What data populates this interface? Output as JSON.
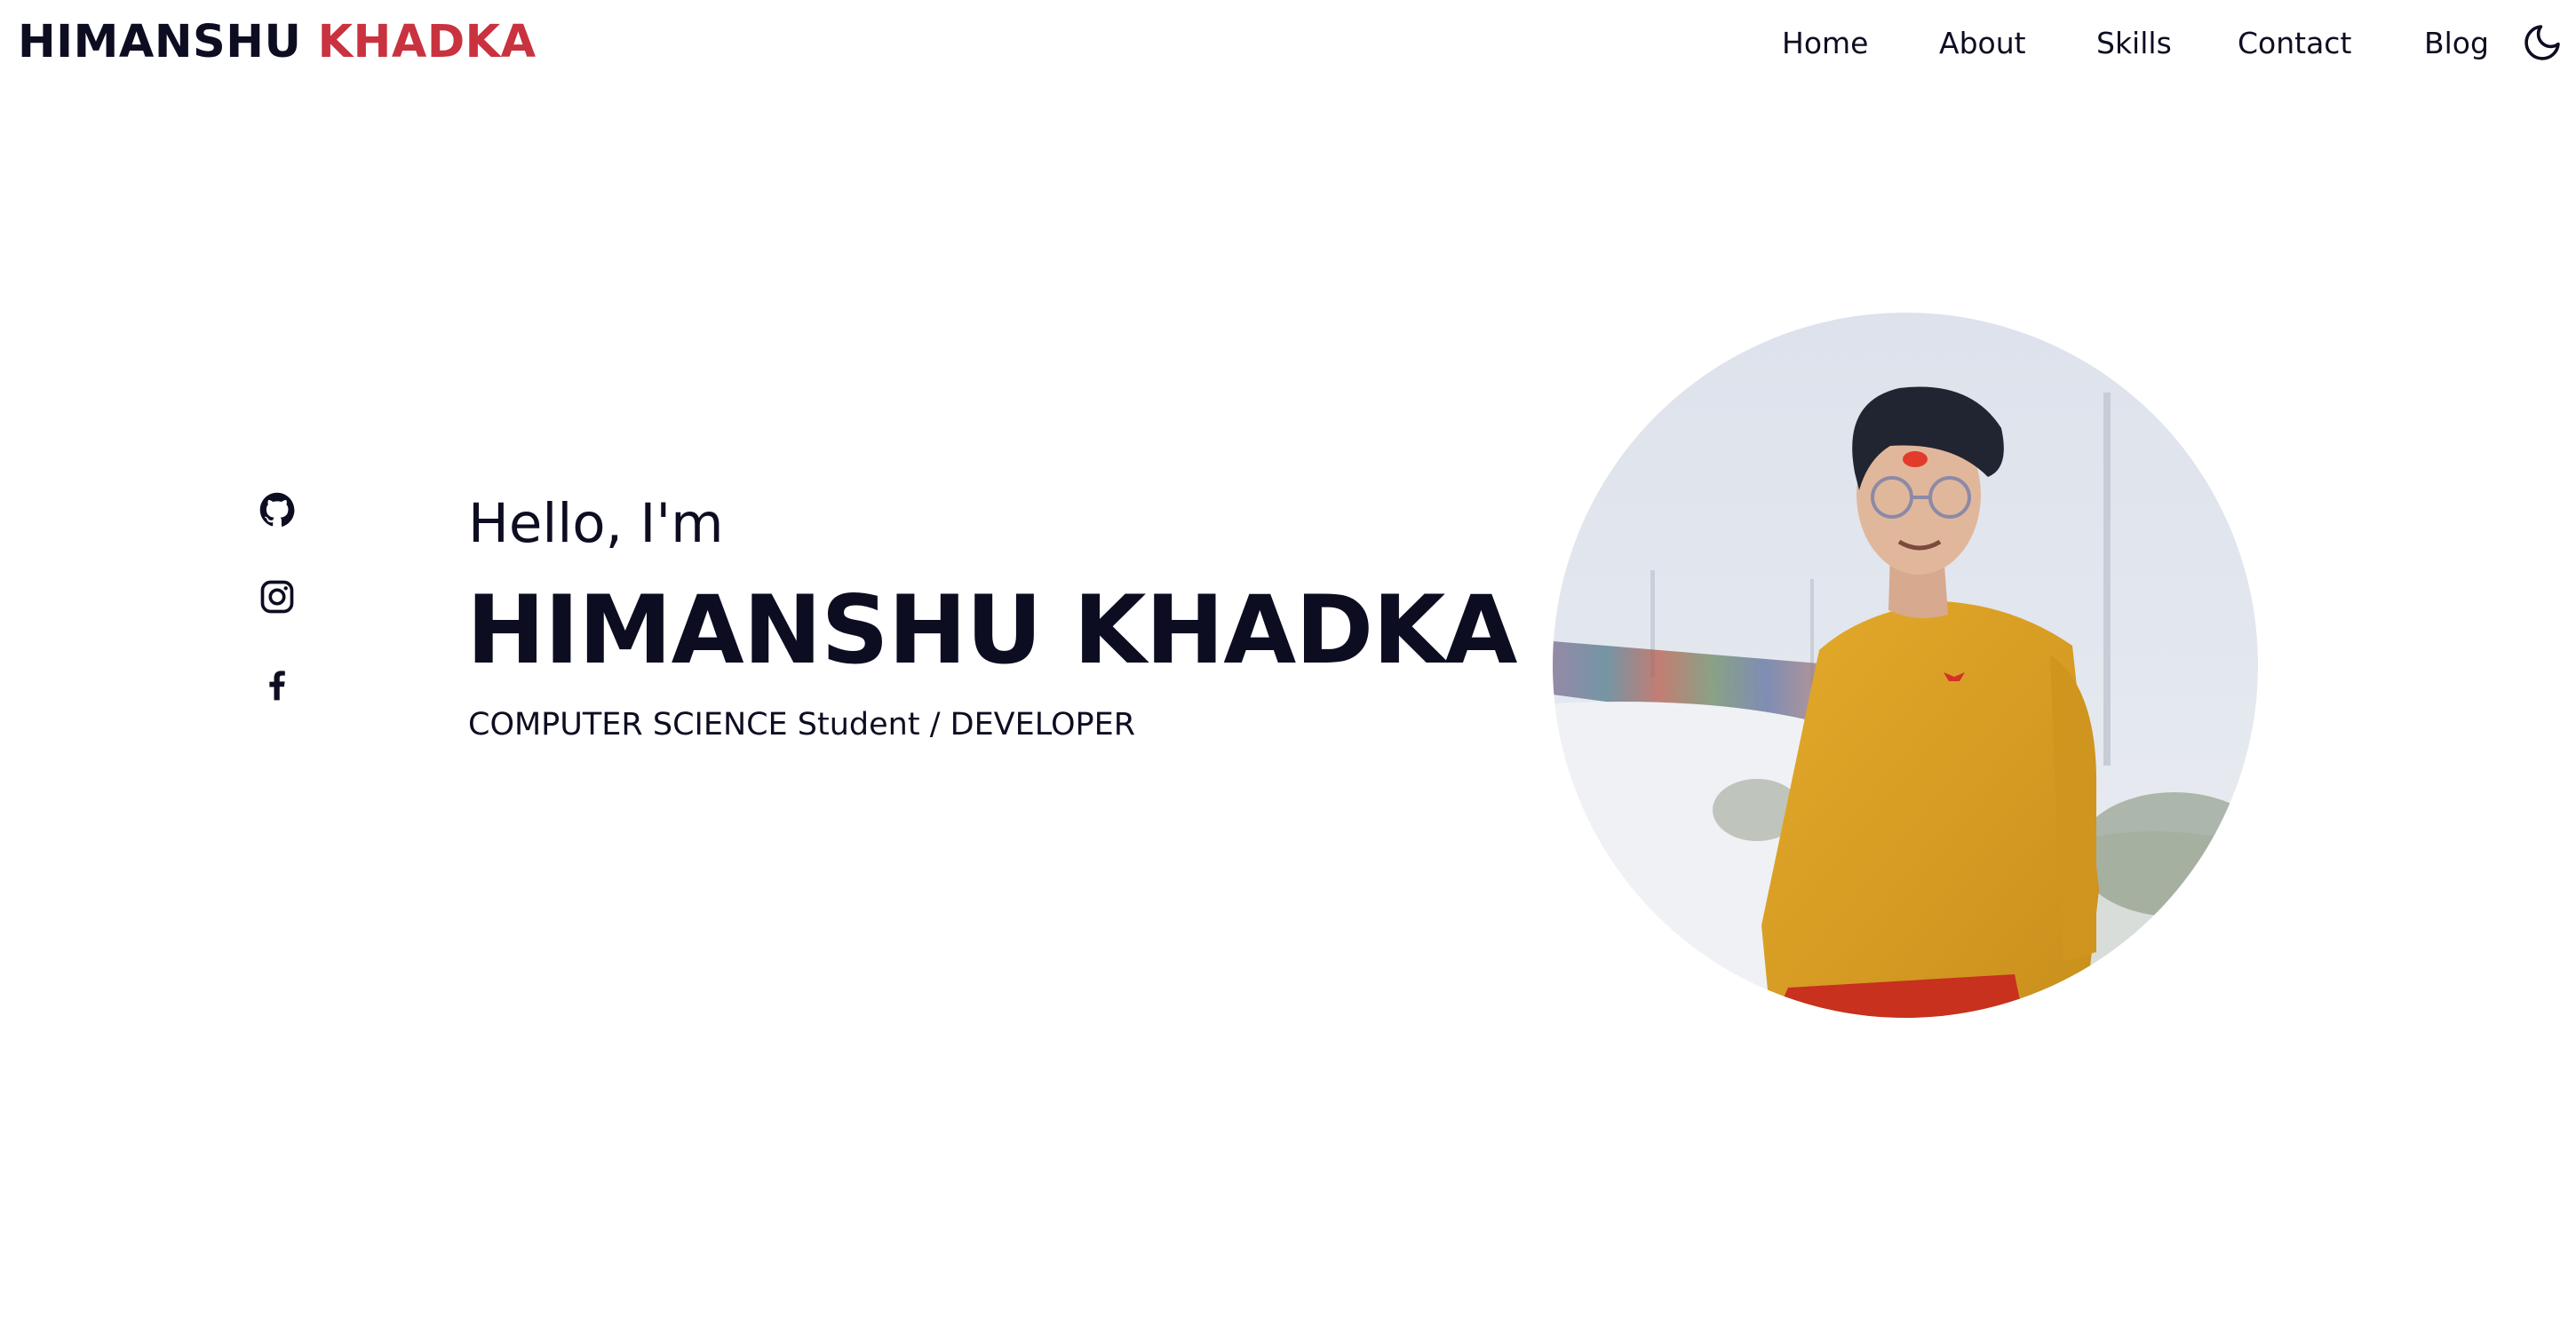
{
  "header": {
    "logo_first": "HIMANSHU",
    "logo_last": "KHADKA",
    "nav": [
      {
        "label": "Home"
      },
      {
        "label": "About"
      },
      {
        "label": "Skills"
      },
      {
        "label": "Contact"
      },
      {
        "label": "Blog"
      }
    ],
    "theme_toggle_icon": "moon-icon"
  },
  "social": [
    {
      "icon": "github-icon"
    },
    {
      "icon": "instagram-icon"
    },
    {
      "icon": "facebook-icon"
    }
  ],
  "hero": {
    "greeting": "Hello, I'm",
    "name": "HIMANSHU KHADKA",
    "subtitle": "COMPUTER SCIENCE Student / DEVELOPER"
  },
  "colors": {
    "text": "#0d0d22",
    "accent": "#c9323f",
    "background": "#ffffff"
  }
}
